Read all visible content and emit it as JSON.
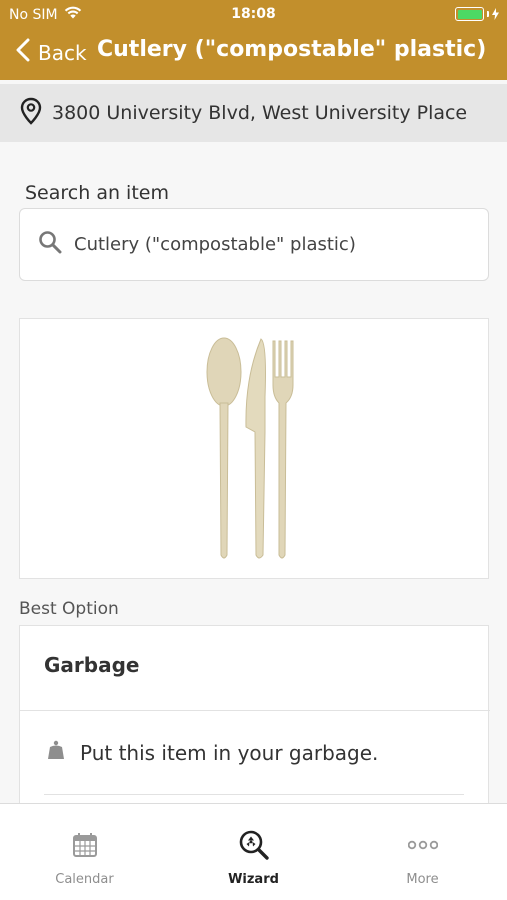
{
  "status_bar": {
    "carrier": "No SIM",
    "time": "18:08"
  },
  "nav": {
    "back_label": "Back",
    "title": "Cutlery (\"compostable\" plastic)"
  },
  "location": {
    "address": "3800 University Blvd, West University Place"
  },
  "search": {
    "label": "Search an item",
    "value": "Cutlery (\"compostable\" plastic)"
  },
  "best_option": {
    "section_label": "Best Option",
    "title": "Garbage",
    "instruction": "Put this item in your garbage."
  },
  "tabs": [
    {
      "label": "Calendar",
      "icon": "calendar-icon",
      "active": false
    },
    {
      "label": "Wizard",
      "icon": "wizard-search-icon",
      "active": true
    },
    {
      "label": "More",
      "icon": "more-icon",
      "active": false
    }
  ],
  "colors": {
    "header": "#c28f2c",
    "battery": "#4cd964"
  }
}
